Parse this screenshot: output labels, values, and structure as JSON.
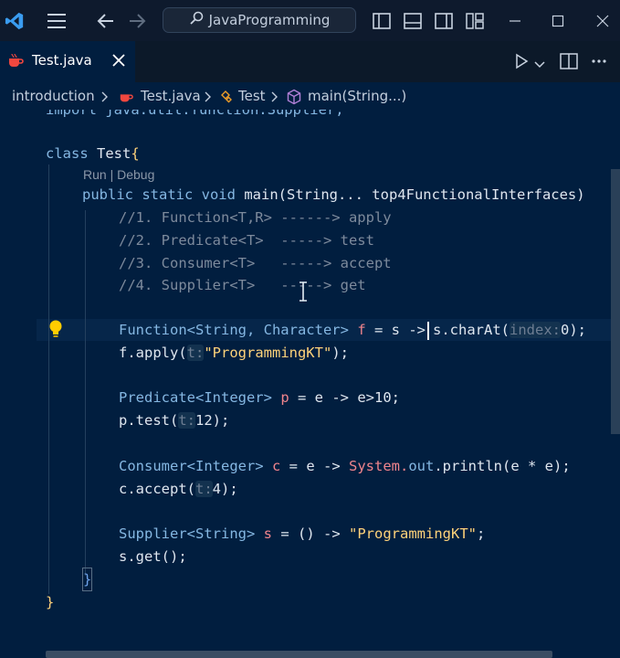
{
  "titlebar": {
    "search_text": "JavaProgramming",
    "icons": [
      "vscode-logo",
      "menu-icon",
      "back-arrow-icon",
      "forward-arrow-icon",
      "search-icon",
      "toggle-primary-sidebar-icon",
      "toggle-panel-icon",
      "toggle-secondary-sidebar-icon",
      "customize-layout-icon",
      "minimize-icon",
      "maximize-icon",
      "close-window-icon"
    ]
  },
  "tab": {
    "label": "Test.java",
    "icon": "java-icon"
  },
  "breadcrumb": {
    "items": [
      "introduction",
      "Test.java",
      "Test",
      "main(String...)"
    ]
  },
  "code": {
    "import_line": "import java.util.function.Supplier;",
    "class_kw": "class",
    "class_name": "Test",
    "brace_open": "{",
    "codelens": "Run | Debug",
    "main_sig_kw": "public static void",
    "main_sig_name": "main",
    "main_sig_params": "(String... top4FunctionalInterfaces)",
    "comments": [
      "//1. Function<T,R> ------> apply",
      "//2. Predicate<T>  -----> test",
      "//3. Consumer<T>   -----> accept",
      "//4. Supplier<T>   -----> get"
    ],
    "l_function_type": "Function<String, Character>",
    "l_function_var": "f",
    "l_function_mid": "= s ->",
    "l_function_call": "s.charAt(",
    "l_function_hint": "index:",
    "l_function_arg": "0",
    "l_function_end": ");",
    "l_apply_start": "f.apply(",
    "l_apply_hint": "t:",
    "l_apply_arg": "\"ProgrammingKT\"",
    "l_apply_end": ");",
    "l_pred_type": "Predicate<Integer>",
    "l_pred_var": "p",
    "l_pred_rest": "= e -> e>10;",
    "l_test_start": "p.test(",
    "l_test_hint": "t:",
    "l_test_arg": "12",
    "l_test_end": ");",
    "l_cons_type": "Consumer<Integer>",
    "l_cons_var": "c",
    "l_cons_mid": "= e ->",
    "l_cons_sys": "System.",
    "l_cons_out": "out",
    "l_cons_rest": ".println(e * e);",
    "l_accept_start": "c.accept(",
    "l_accept_hint": "t:",
    "l_accept_arg": "4",
    "l_accept_end": ");",
    "l_supp_type": "Supplier<String>",
    "l_supp_var": "s",
    "l_supp_mid": "= () ->",
    "l_supp_str": "\"ProgrammingKT\"",
    "l_supp_end": ";",
    "l_get": "s.get();",
    "brace_close_inner": "}",
    "brace_close_outer": "}"
  },
  "colors": {
    "editor_bg": "#011e3f",
    "keyword": "#85b7e2",
    "string": "#ffd27a",
    "comment": "#7d8a9c",
    "variable": "#f0848c"
  }
}
